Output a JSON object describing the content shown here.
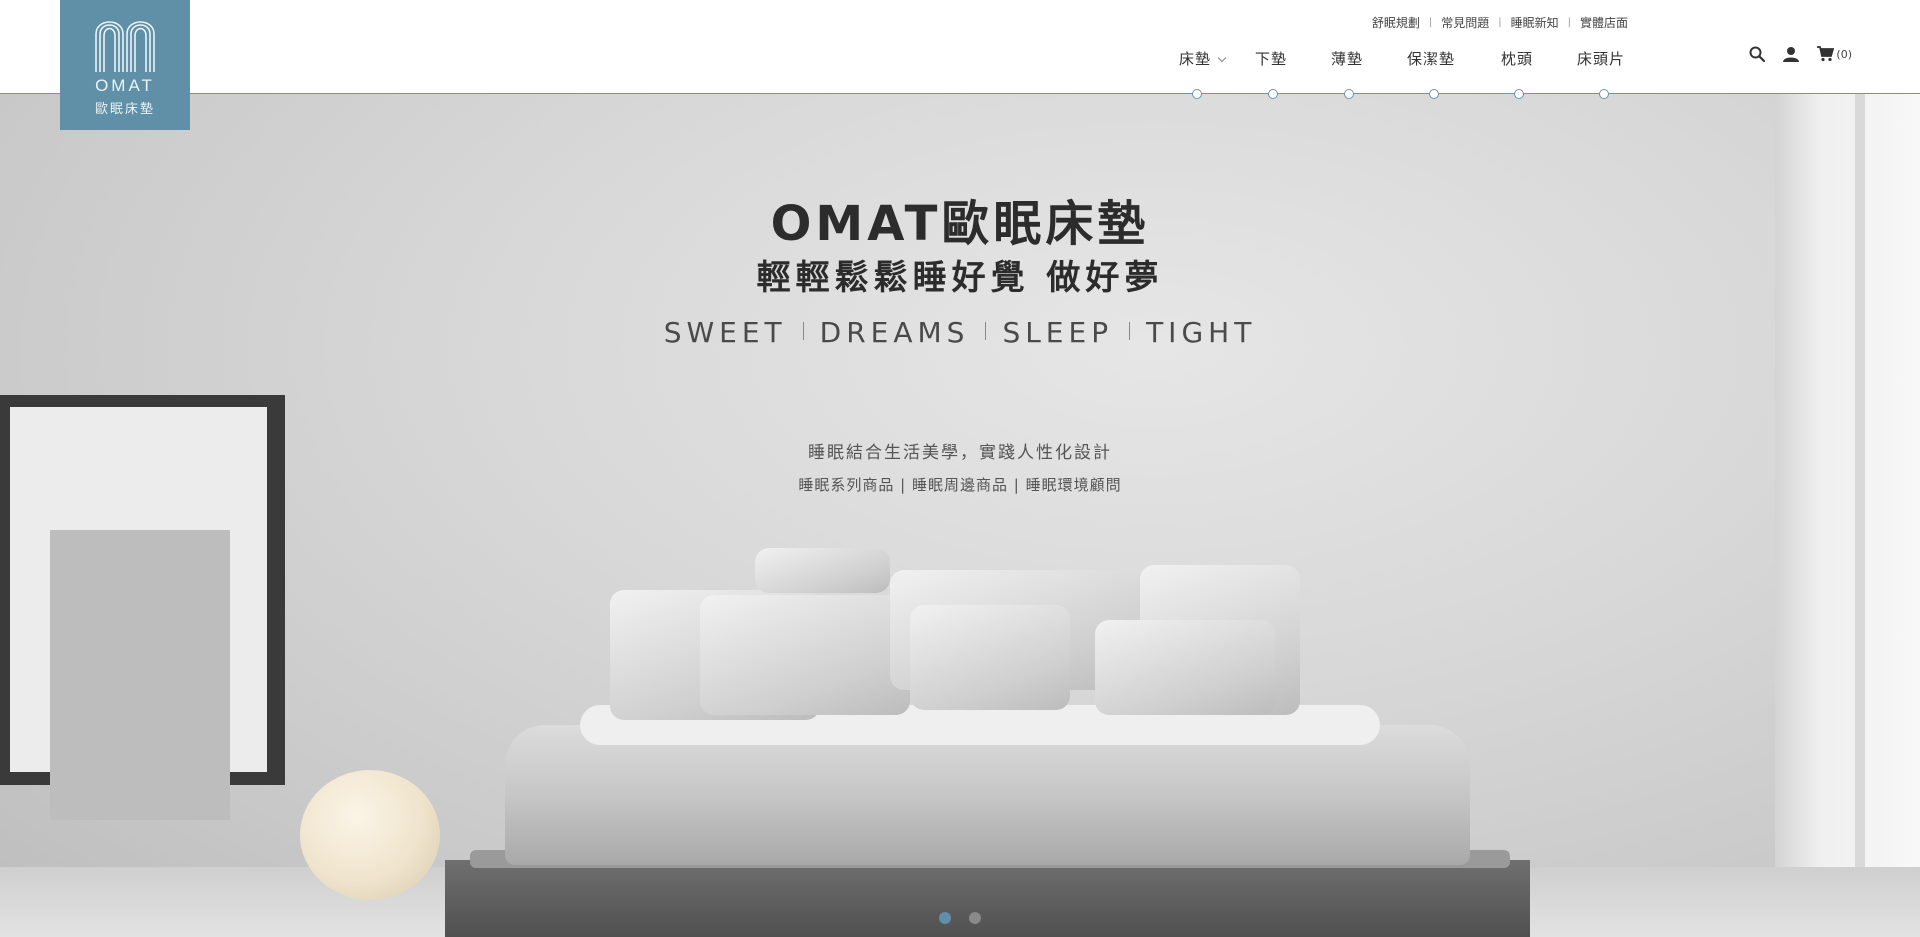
{
  "brand": {
    "logo_en": "OMAT",
    "logo_cn": "歐眠床墊",
    "color": "#5f90a7"
  },
  "top_links": [
    {
      "label": "舒眠規劃"
    },
    {
      "label": "常見問題"
    },
    {
      "label": "睡眠新知"
    },
    {
      "label": "實體店面"
    }
  ],
  "nav": [
    {
      "label": "床墊",
      "has_dropdown": true
    },
    {
      "label": "下墊"
    },
    {
      "label": "薄墊"
    },
    {
      "label": "保潔墊"
    },
    {
      "label": "枕頭"
    },
    {
      "label": "床頭片"
    }
  ],
  "icons": {
    "search": "search-icon",
    "account": "user-icon",
    "cart": "cart-icon",
    "cart_count": "(0)"
  },
  "hero": {
    "title": "OMAT歐眠床墊",
    "subtitle": "輕輕鬆鬆睡好覺  做好夢",
    "tagline_words": [
      "SWEET",
      "DREAMS",
      "SLEEP",
      "TIGHT"
    ],
    "description": "睡眠結合生活美學，實踐人性化設計",
    "services": "睡眠系列商品 | 睡眠周邊商品 | 睡眠環境顧問"
  },
  "carousel": {
    "total": 2,
    "active": 1,
    "active_color": "#5f90a7",
    "inactive_color": "#8a8a8a"
  }
}
